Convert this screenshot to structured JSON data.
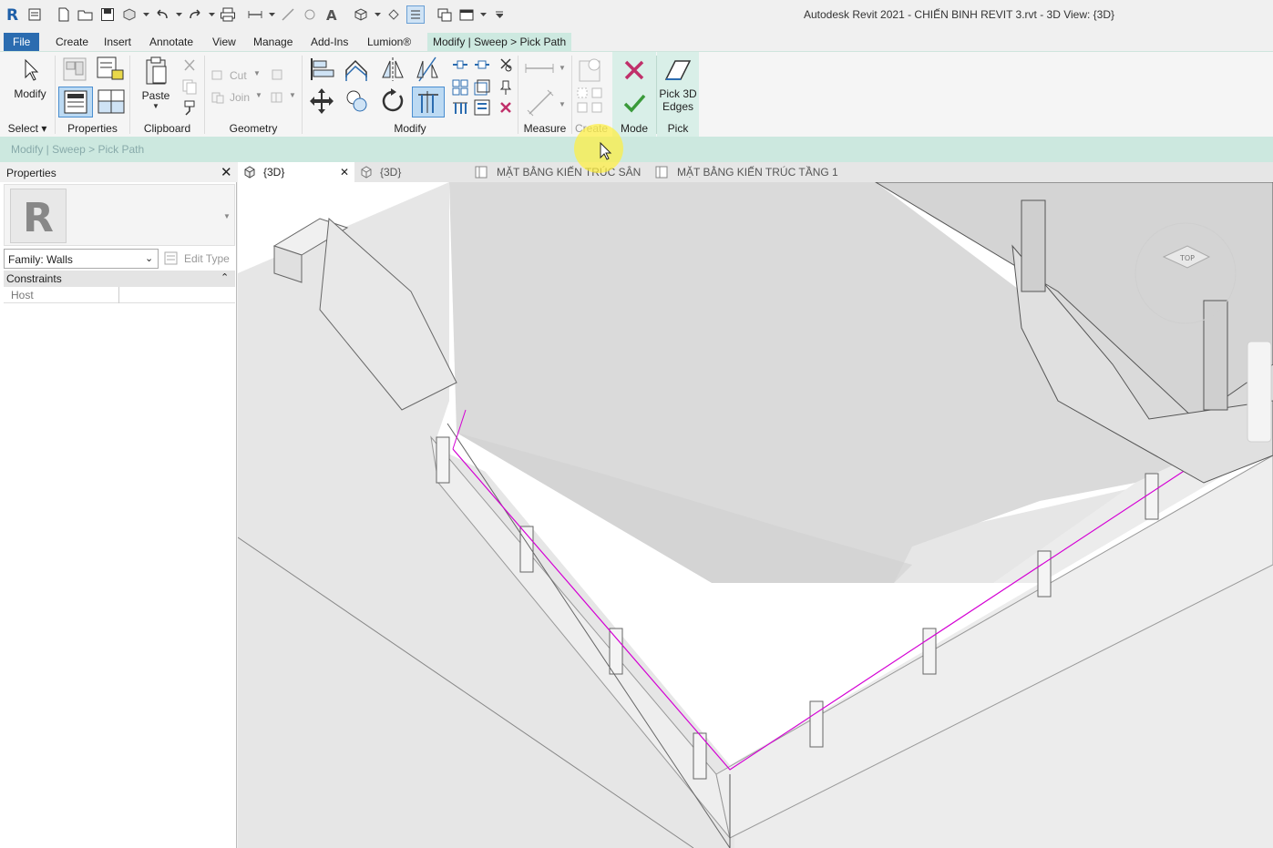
{
  "window": {
    "title": "Autodesk Revit 2021 - CHIẾN BINH REVIT 3.rvt - 3D View: {3D}"
  },
  "menu": {
    "tabs": [
      "File",
      "Create",
      "Insert",
      "Annotate",
      "View",
      "Manage",
      "Add-Ins",
      "Lumion®",
      "Modify | Sweep > Pick Path"
    ]
  },
  "ribbon": {
    "modify_label": "Modify",
    "select_label": "Select",
    "properties_label": "Properties",
    "paste_label": "Paste",
    "clipboard_label": "Clipboard",
    "cut_label": "Cut",
    "join_label": "Join",
    "geometry_label": "Geometry",
    "modify_panel_label": "Modify",
    "measure_label": "Measure",
    "create_label": "Create",
    "mode_label": "Mode",
    "pick3d_line1": "Pick 3D",
    "pick3d_line2": "Edges",
    "pick_label": "Pick"
  },
  "options_bar": {
    "text": "Modify | Sweep > Pick Path"
  },
  "properties": {
    "title": "Properties",
    "family": "Family: Walls",
    "edit_type": "Edit Type",
    "section": "Constraints",
    "rows": [
      {
        "label": "Host",
        "value": ""
      }
    ]
  },
  "view_tabs": [
    "{3D}",
    "{3D}",
    "MẶT BẰNG KIẾN TRÚC SÂN",
    "MẶT BẰNG KIẾN TRÚC TẦNG 1"
  ],
  "colors": {
    "file_tab": "#2b6cb0",
    "context_tab": "#cde9e0",
    "path_line": "#d400d4",
    "cancel": "#c0306a",
    "finish": "#3a9a3a"
  }
}
